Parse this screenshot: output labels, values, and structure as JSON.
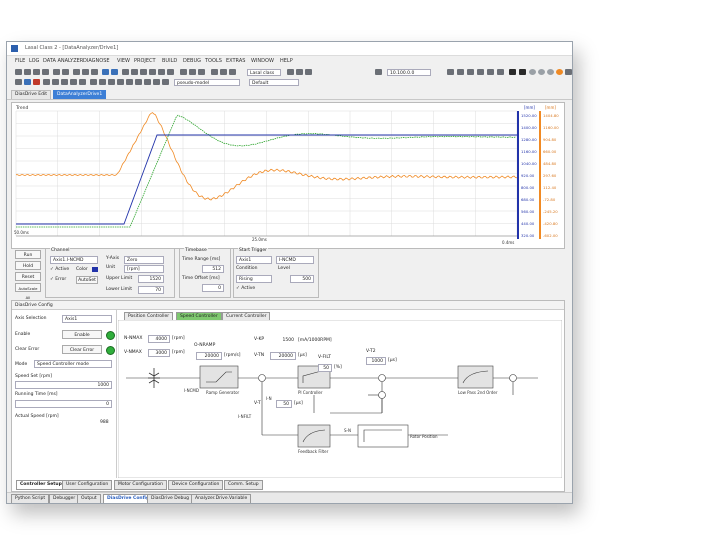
{
  "window": {
    "title": "Lasal Class 2 - [DataAnalyzer/Drive1]"
  },
  "menu": [
    "FILE",
    "LOG",
    "DATA ANALYZER",
    "DIAGNOSE",
    "VIEW",
    "PROJECT",
    "BUILD",
    "DEBUG",
    "TOOLS",
    "EXTRAS",
    "WINDOW",
    "HELP"
  ],
  "toolbar": {
    "combo1": "Lasal class",
    "combo2": "pseudo-model",
    "combo3": "Default",
    "combo4": "10.100.0.0"
  },
  "doc_tabs": [
    "DiasDrive Edit",
    "DataAnalyzerDrive1"
  ],
  "plot": {
    "label": "Trend",
    "left_scale_top": "0.00",
    "x_left": "50.0ms",
    "x_mid": "25.0ms",
    "x_right": "0.4ms",
    "units_blue": "[mm]",
    "units_orange": "[mm]",
    "blue_ticks": [
      "1520.00",
      "1400.00",
      "1280.00",
      "1160.00",
      "1040.00",
      "920.00",
      "800.00",
      "680.00",
      "560.00",
      "440.00",
      "320.00"
    ],
    "orange_ticks": [
      "1404.80",
      "1160.00",
      "904.80",
      "660.00",
      "484.80",
      "297.60",
      "112.40",
      "-72.80",
      "-245.20",
      "-420.80",
      "-602.00"
    ]
  },
  "controls": {
    "buttons": [
      "Run",
      "Hold",
      "Reset",
      "AutoScale All"
    ],
    "channel": {
      "title": "Channel",
      "select": "Axis1.I-NCMD",
      "active": "Active",
      "color": "Color",
      "error": "Error",
      "autoset": "AutoSet"
    },
    "yaxis": {
      "label": "Y-Axis",
      "value": "Zero",
      "unit_label": "Unit",
      "unit_value": "[rpm]",
      "upper_label": "Upper Limit",
      "upper": "1520",
      "lower_label": "Lower Limit",
      "lower": "70"
    },
    "timebase": {
      "title": "Timebase",
      "range_label": "Time Range [ms]",
      "range": "512",
      "offset_label": "Time Offset [ms]",
      "offset": "0"
    },
    "trigger": {
      "title": "Start Trigger",
      "axis": "Axis1",
      "channel": "I-NCMD",
      "cond_label": "Condition",
      "cond": "Rising",
      "level_label": "Level",
      "level": "500",
      "active": "Active"
    }
  },
  "config": {
    "header": "DiasDrive Config",
    "axis_label": "Axis Selection",
    "axis": "Axis1",
    "enable_label": "Enable",
    "enable_btn": "Enable",
    "clear_label": "Clear Error",
    "clear_btn": "Clear Error",
    "mode_label": "Mode",
    "mode": "Speed Controller mode",
    "speed_label": "Speed Set [rpm]",
    "speed": "1000",
    "ramp_label": "Running Time [ms]",
    "ramp": "0",
    "actual_label": "Actual Speed [rpm]",
    "actual": "988"
  },
  "diagram": {
    "tabs": [
      "Position Controller",
      "Speed Controller",
      "Current Controller"
    ],
    "n_nmax_label": "N-NMAX",
    "n_nmax": "4000",
    "n_nmax_unit": "[rpm]",
    "v_nmax_label": "V-NMAX",
    "v_nmax": "3000",
    "v_nmax_unit": "[rpm]",
    "o_nramp_label": "O-NRAMP",
    "o_nramp": "20000",
    "o_nramp_unit": "[rpm/s]",
    "v_kp_label": "V-KP",
    "v_kp": "1500",
    "v_kp_unit": "[mA/1000RPM]",
    "v_tn_label": "V-TN",
    "v_tn": "20000",
    "v_tn_unit": "[µs]",
    "v_filt_label": "V-FILT",
    "v_filt": "50",
    "v_filt_unit": "[%]",
    "v_t2_label": "V-T2",
    "v_t2": "1000",
    "v_t2_unit": "[µs]",
    "v_t_label": "V-T",
    "v_t": "50",
    "v_t_unit": "[µs]",
    "i_ncmd": "I-NCMD",
    "i_n": "I-N",
    "i_filt": "I-NFILT",
    "s_n": "S-N",
    "block1": "Ramp Generator",
    "block2": "PI Controller",
    "block3": "Low Pass 2nd Order",
    "block4": "Feedback Filter",
    "rotor_pos": "Rotor Position"
  },
  "bottom_tabs": [
    "Controller Setup",
    "User Configuration",
    "Motor Configuration",
    "Device Configuration",
    "Comm. Setup"
  ],
  "status_tabs": [
    "Python Script",
    "Debugger",
    "Output",
    "DiasDrive Config",
    "DiasDrive Debug",
    "Analyzer.Drive.Variable"
  ]
}
